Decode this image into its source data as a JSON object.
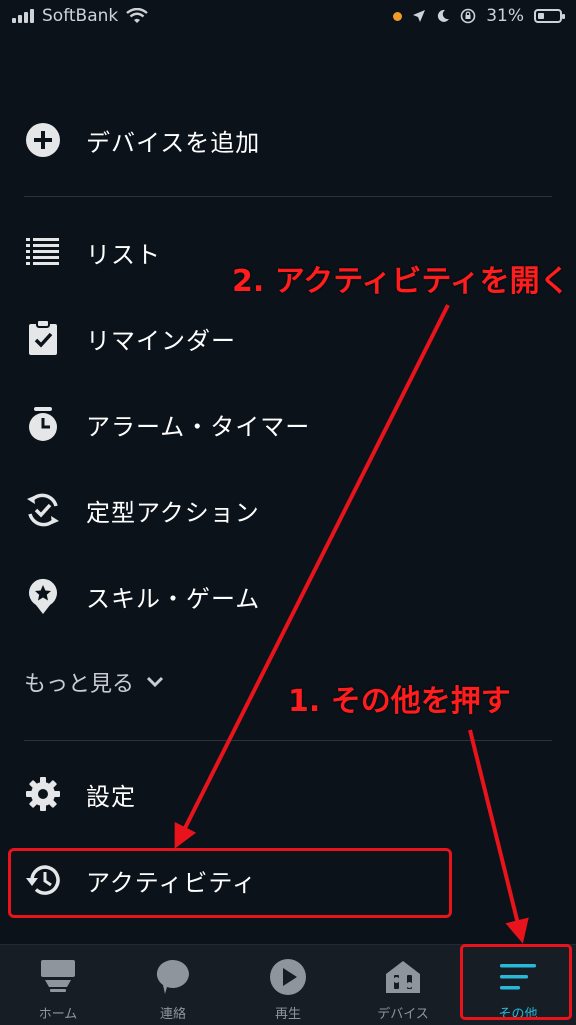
{
  "status_bar": {
    "carrier": "SoftBank",
    "battery": "31%"
  },
  "menu": {
    "add_device": "デバイスを追加",
    "list": "リスト",
    "reminder": "リマインダー",
    "alarm_timer": "アラーム・タイマー",
    "routine": "定型アクション",
    "skills_games": "スキル・ゲーム",
    "see_more": "もっと見る",
    "settings": "設定",
    "activity": "アクティビティ"
  },
  "annotations": {
    "step2": "2. アクティビティを開く",
    "step1": "1. その他を押す"
  },
  "tabbar": {
    "home": "ホーム",
    "contact": "連絡",
    "play": "再生",
    "devices": "デバイス",
    "more": "その他"
  },
  "colors": {
    "background": "#0b121a",
    "accent": "#28b8d8",
    "annotation": "#e8131b"
  }
}
